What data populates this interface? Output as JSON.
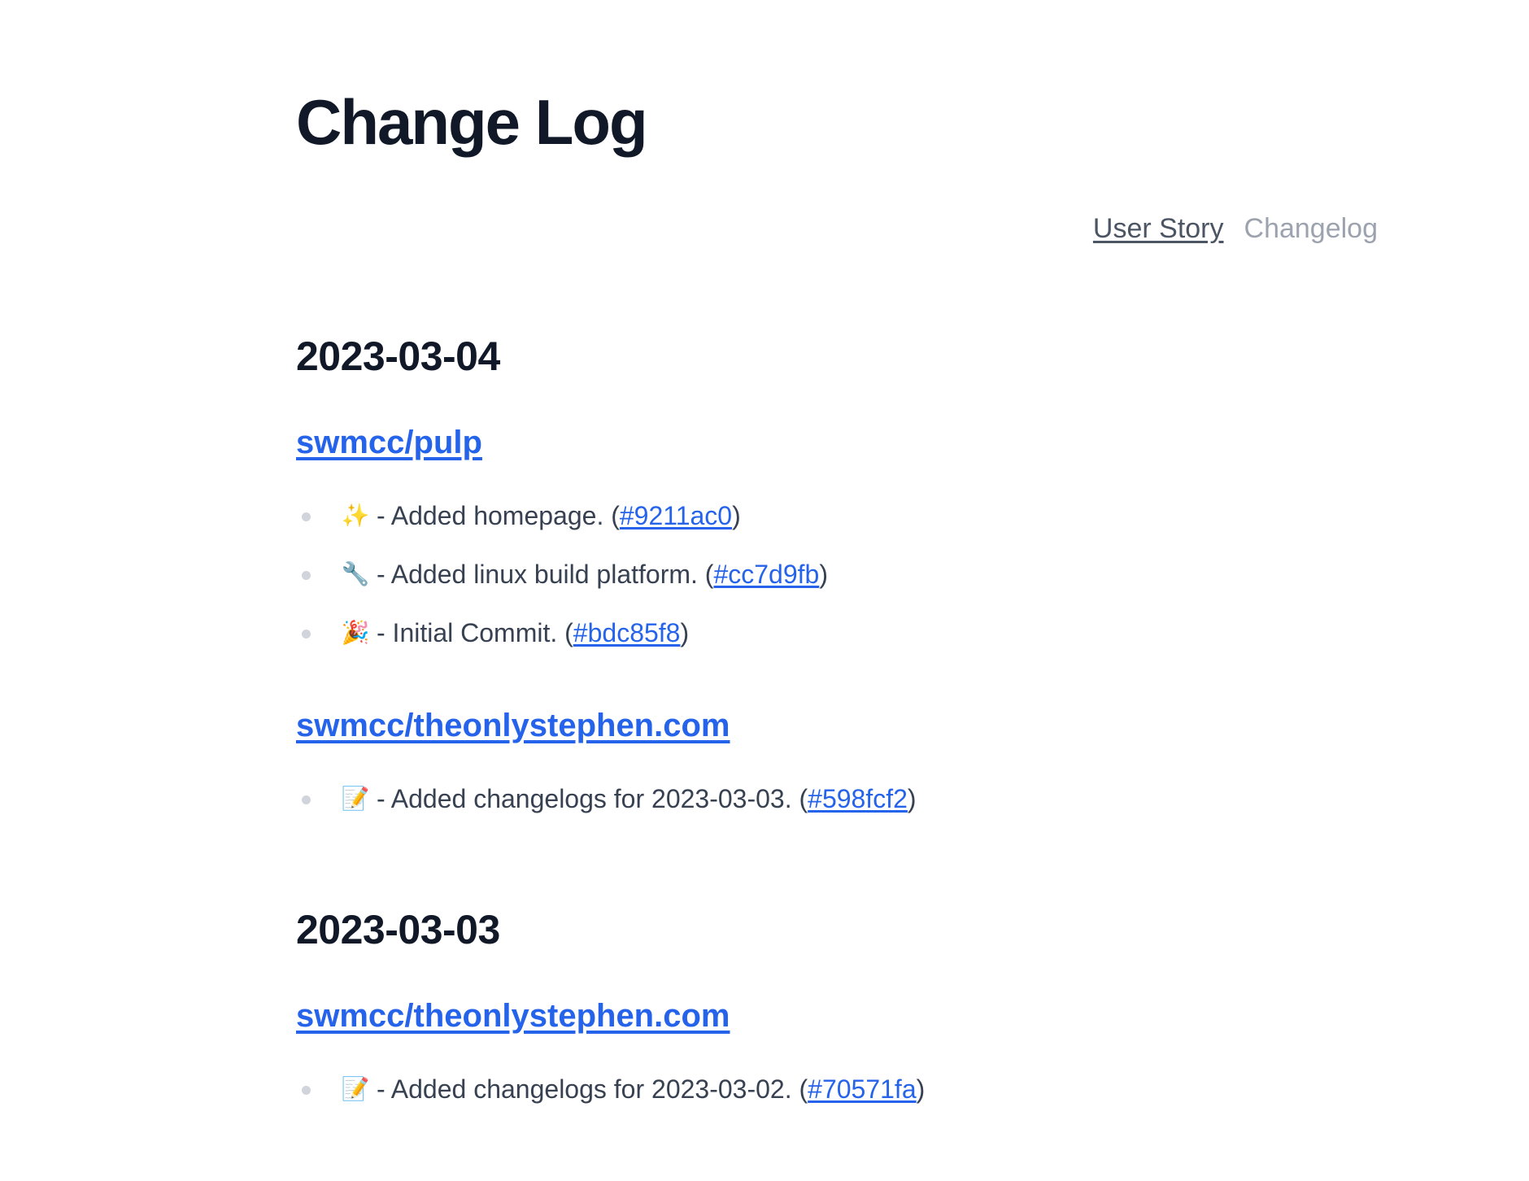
{
  "title": "Change Log",
  "nav": {
    "user_story": "User Story",
    "changelog": "Changelog"
  },
  "days": [
    {
      "date": "2023-03-04",
      "repos": [
        {
          "name": "swmcc/pulp",
          "items": [
            {
              "emoji": "✨",
              "text": " - Added homepage. (",
              "hash": "#9211ac0",
              "close": ")"
            },
            {
              "emoji": "🔧",
              "text": " - Added linux build platform. (",
              "hash": "#cc7d9fb",
              "close": ")"
            },
            {
              "emoji": "🎉",
              "text": " - Initial Commit. (",
              "hash": "#bdc85f8",
              "close": ")"
            }
          ]
        },
        {
          "name": "swmcc/theonlystephen.com",
          "items": [
            {
              "emoji": "📝",
              "text": " - Added changelogs for 2023-03-03. (",
              "hash": "#598fcf2",
              "close": ")"
            }
          ]
        }
      ]
    },
    {
      "date": "2023-03-03",
      "repos": [
        {
          "name": "swmcc/theonlystephen.com",
          "items": [
            {
              "emoji": "📝",
              "text": " - Added changelogs for 2023-03-02. (",
              "hash": "#70571fa",
              "close": ")"
            }
          ]
        }
      ]
    }
  ]
}
